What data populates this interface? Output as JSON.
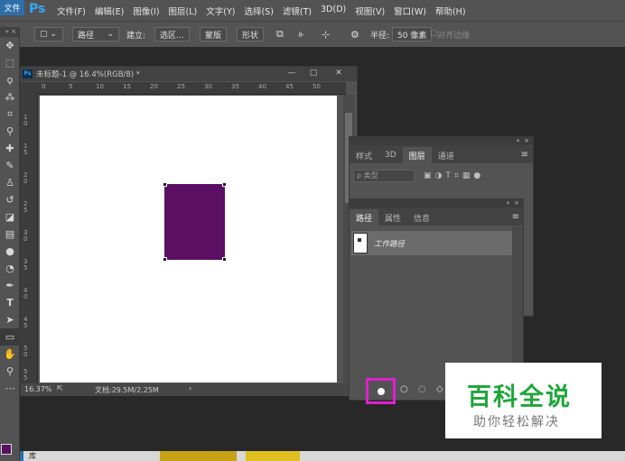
{
  "menubar": {
    "file_tab": "文件",
    "logo": "Ps",
    "items": [
      "文件(F)",
      "编辑(E)",
      "图像(I)",
      "图层(L)",
      "文字(Y)",
      "选择(S)",
      "滤镜(T)",
      "3D(D)",
      "视图(V)",
      "窗口(W)",
      "帮助(H)"
    ]
  },
  "options": {
    "mode": "路径",
    "build_label": "建立:",
    "selection": "选区...",
    "mask": "蒙版",
    "shape": "形状",
    "radius_label": "半径:",
    "radius_value": "50 像素",
    "align_edges": "对齐边缘"
  },
  "document": {
    "title": "未标题-1 @ 16.4%(RGB/8) *",
    "ps_icon": "Ps",
    "ruler_top": [
      "0",
      "5",
      "10",
      "15",
      "20",
      "25",
      "30",
      "35",
      "40",
      "45",
      "50"
    ],
    "ruler_left": [
      "1 0",
      "1 5",
      "2 0",
      "2 5",
      "3 0",
      "3 5",
      "4 0",
      "4 5",
      "5 0",
      "5 5"
    ],
    "zoom": "16.37%",
    "doc_size": "文档:29.5M/2.25M",
    "shape_color": "#5b0f63"
  },
  "layers_panel": {
    "tabs": [
      "样式",
      "3D",
      "图层",
      "通道"
    ],
    "active_tab": "图层",
    "filter_placeholder": "ρ 类型"
  },
  "paths_panel": {
    "tabs": [
      "路径",
      "属性",
      "信息"
    ],
    "active_tab": "路径",
    "path_name": "工作路径"
  },
  "watermark": {
    "title": "百科全说",
    "subtitle": "助你轻松解决"
  },
  "taskbar": {
    "label": "库"
  },
  "colors": {
    "foreground": "#5b0f63",
    "highlight": "#e020d0"
  }
}
